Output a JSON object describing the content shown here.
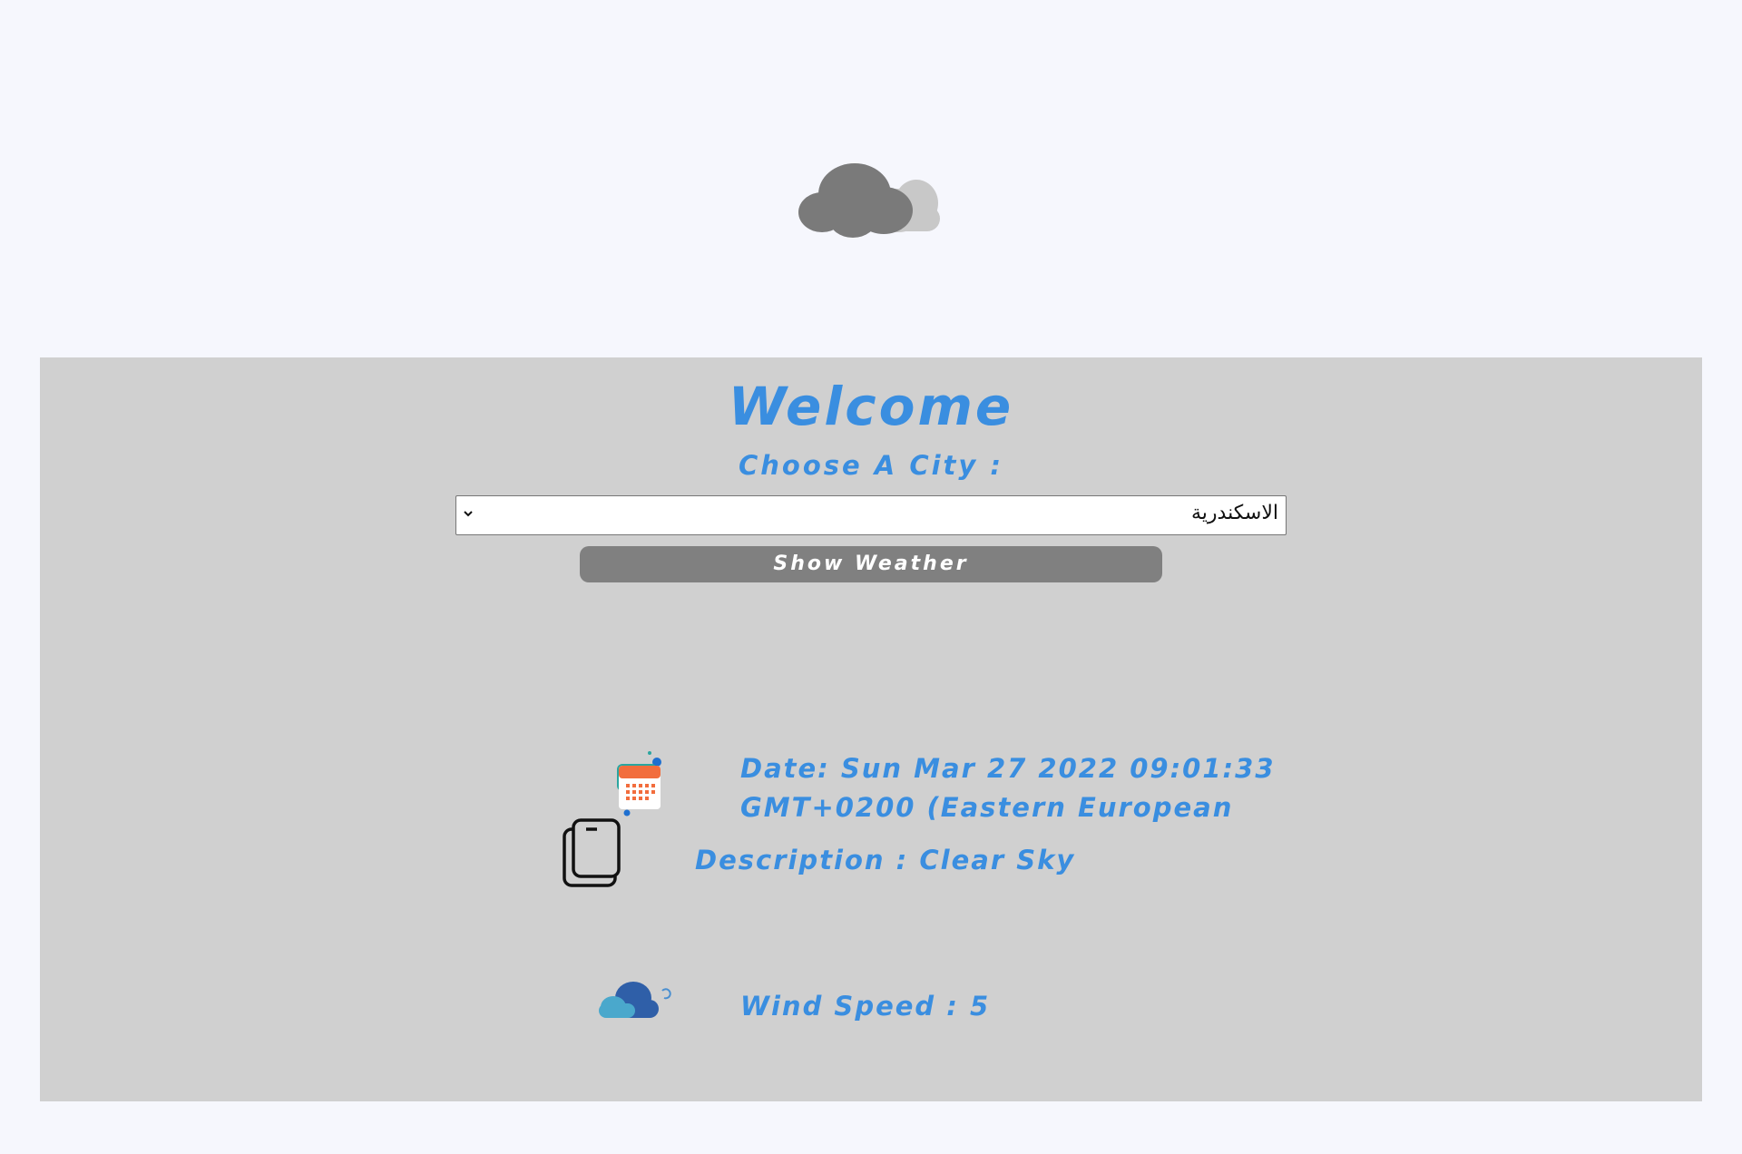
{
  "header": {
    "cloud_icon": "cloud-icon"
  },
  "panel": {
    "welcome": "Welcome",
    "choose_label": "Choose A City :",
    "city_select": {
      "selected": "الاسكندرية"
    },
    "show_button": "Show Weather"
  },
  "weather": {
    "date": "Date: Sun Mar 27 2022 09:01:33 GMT+0200 (Eastern European",
    "description": "Description : Clear Sky",
    "wind": "Wind Speed : 5",
    "icons": [
      "calendar-icon",
      "copy-icon",
      "cloud-icon"
    ]
  },
  "colors": {
    "accent": "#3a8ee0",
    "panel_bg": "#d0d0d0",
    "page_bg": "#f6f7fd",
    "button_bg": "#808080"
  }
}
